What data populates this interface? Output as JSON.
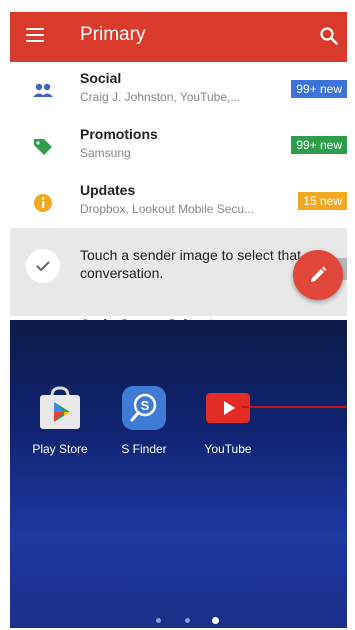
{
  "gmail": {
    "title": "Primary",
    "icons": {
      "menu": "menu-icon",
      "search": "search-icon",
      "compose": "pencil-icon"
    },
    "categories": [
      {
        "label": "Social",
        "sub": "Craig J. Johnston, YouTube,...",
        "badge": "99+ new",
        "badge_color": "#3b73d9",
        "icon": "people-icon",
        "icon_color": "#3d63c9"
      },
      {
        "label": "Promotions",
        "sub": "Samsung",
        "badge": "99+ new",
        "badge_color": "#2e9e4b",
        "icon": "tag-icon",
        "icon_color": "#2e9e4b"
      },
      {
        "label": "Updates",
        "sub": "Dropbox, Lookout Mobile Secu...",
        "badge": "15 new",
        "badge_color": "#f2a922",
        "icon": "info-icon",
        "icon_color": "#f2a922"
      }
    ],
    "tip": "Touch a sender image to select that conversation.",
    "next_sender": "Craig James Johnston",
    "accent": "#d93a2b"
  },
  "home": {
    "apps": [
      {
        "name": "Play Store",
        "icon": "play-store-icon"
      },
      {
        "name": "S Finder",
        "icon": "s-finder-icon"
      },
      {
        "name": "YouTube",
        "icon": "youtube-icon"
      }
    ],
    "pages": {
      "count": 3,
      "current": 3
    }
  }
}
